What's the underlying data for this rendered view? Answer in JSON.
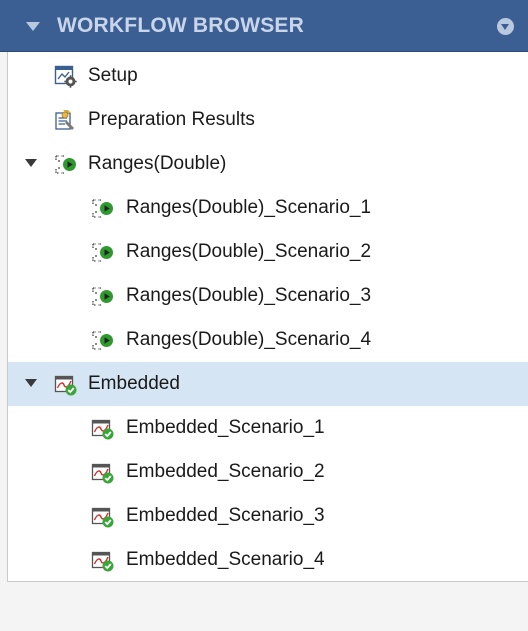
{
  "header": {
    "title": "WORKFLOW BROWSER"
  },
  "tree": {
    "items": [
      {
        "label": "Setup",
        "icon": "setup-icon",
        "level": 0,
        "expanded": null,
        "selected": false
      },
      {
        "label": "Preparation Results",
        "icon": "preparation-results-icon",
        "level": 0,
        "expanded": null,
        "selected": false
      },
      {
        "label": "Ranges(Double)",
        "icon": "ranges-run-icon",
        "level": 0,
        "expanded": true,
        "selected": false
      },
      {
        "label": "Ranges(Double)_Scenario_1",
        "icon": "ranges-run-icon",
        "level": 1,
        "expanded": null,
        "selected": false
      },
      {
        "label": "Ranges(Double)_Scenario_2",
        "icon": "ranges-run-icon",
        "level": 1,
        "expanded": null,
        "selected": false
      },
      {
        "label": "Ranges(Double)_Scenario_3",
        "icon": "ranges-run-icon",
        "level": 1,
        "expanded": null,
        "selected": false
      },
      {
        "label": "Ranges(Double)_Scenario_4",
        "icon": "ranges-run-icon",
        "level": 1,
        "expanded": null,
        "selected": false
      },
      {
        "label": "Embedded",
        "icon": "embedded-check-icon",
        "level": 0,
        "expanded": true,
        "selected": true
      },
      {
        "label": "Embedded_Scenario_1",
        "icon": "embedded-check-icon",
        "level": 1,
        "expanded": null,
        "selected": false
      },
      {
        "label": "Embedded_Scenario_2",
        "icon": "embedded-check-icon",
        "level": 1,
        "expanded": null,
        "selected": false
      },
      {
        "label": "Embedded_Scenario_3",
        "icon": "embedded-check-icon",
        "level": 1,
        "expanded": null,
        "selected": false
      },
      {
        "label": "Embedded_Scenario_4",
        "icon": "embedded-check-icon",
        "level": 1,
        "expanded": null,
        "selected": false
      }
    ]
  },
  "colors": {
    "header_bg": "#3b5e93",
    "header_text": "#c9d6ea",
    "selection": "#d5e5f4",
    "check_green": "#3aa63a",
    "run_green": "#2e9a2e"
  }
}
